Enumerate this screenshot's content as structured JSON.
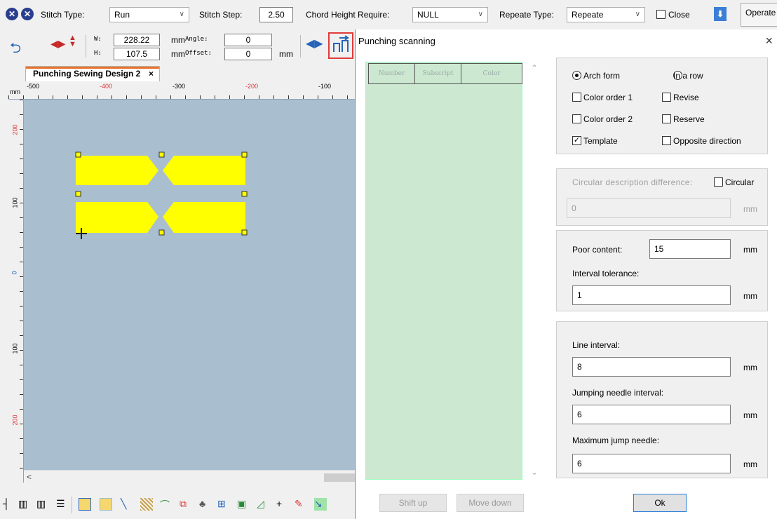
{
  "toolbar": {
    "stitch_type_label": "Stitch Type:",
    "stitch_type_value": "Run",
    "stitch_step_label": "Stitch Step:",
    "stitch_step_value": "2.50",
    "chord_label": "Chord Height Require:",
    "chord_value": "NULL",
    "repeat_type_label": "Repeate Type:",
    "repeat_type_value": "Repeate",
    "close_label": "Close",
    "operate_label": "Operate"
  },
  "transform": {
    "w_label": "W:",
    "w_value": "228.22",
    "h_label": "H:",
    "h_value": "107.5",
    "mm": "mm",
    "angle_label": "Angle:",
    "angle_value": "0",
    "offset_label": "Offset:",
    "offset_value": "0"
  },
  "document": {
    "tab_title": "Punching Sewing Design 2",
    "tab_close": "×",
    "ruler_unit": "mm",
    "h_ticks": [
      "-500",
      "-400",
      "-300",
      "-200",
      "-100"
    ],
    "v_ticks": [
      "200",
      "100",
      "0",
      "100",
      "200"
    ]
  },
  "dialog": {
    "title": "Punching scanning",
    "close": "×",
    "list_headers": [
      "Number",
      "Subscript",
      "Color"
    ],
    "options": {
      "arch_form": "Arch form",
      "in_a_row": "In a row",
      "color_order_1": "Color order 1",
      "revise": "Revise",
      "color_order_2": "Color order 2",
      "reserve": "Reserve",
      "template": "Template",
      "opposite_direction": "Opposite direction"
    },
    "circular_desc_label": "Circular description difference:",
    "circular_label": "Circular",
    "circular_value": "0",
    "poor_content_label": "Poor content:",
    "poor_content_value": "15",
    "interval_tolerance_label": "Interval tolerance:",
    "interval_tolerance_value": "1",
    "line_interval_label": "Line interval:",
    "line_interval_value": "8",
    "jumping_needle_label": "Jumping needle interval:",
    "jumping_needle_value": "6",
    "max_jump_label": "Maximum jump needle:",
    "max_jump_value": "6",
    "mm": "mm",
    "shift_up": "Shift up",
    "move_down": "Move down",
    "ok": "Ok"
  },
  "colors": {
    "shape_fill": "#ffff00",
    "canvas_bg": "#a9bfd0",
    "list_bg": "#cce8d0",
    "accent_red": "#e23b3b"
  }
}
